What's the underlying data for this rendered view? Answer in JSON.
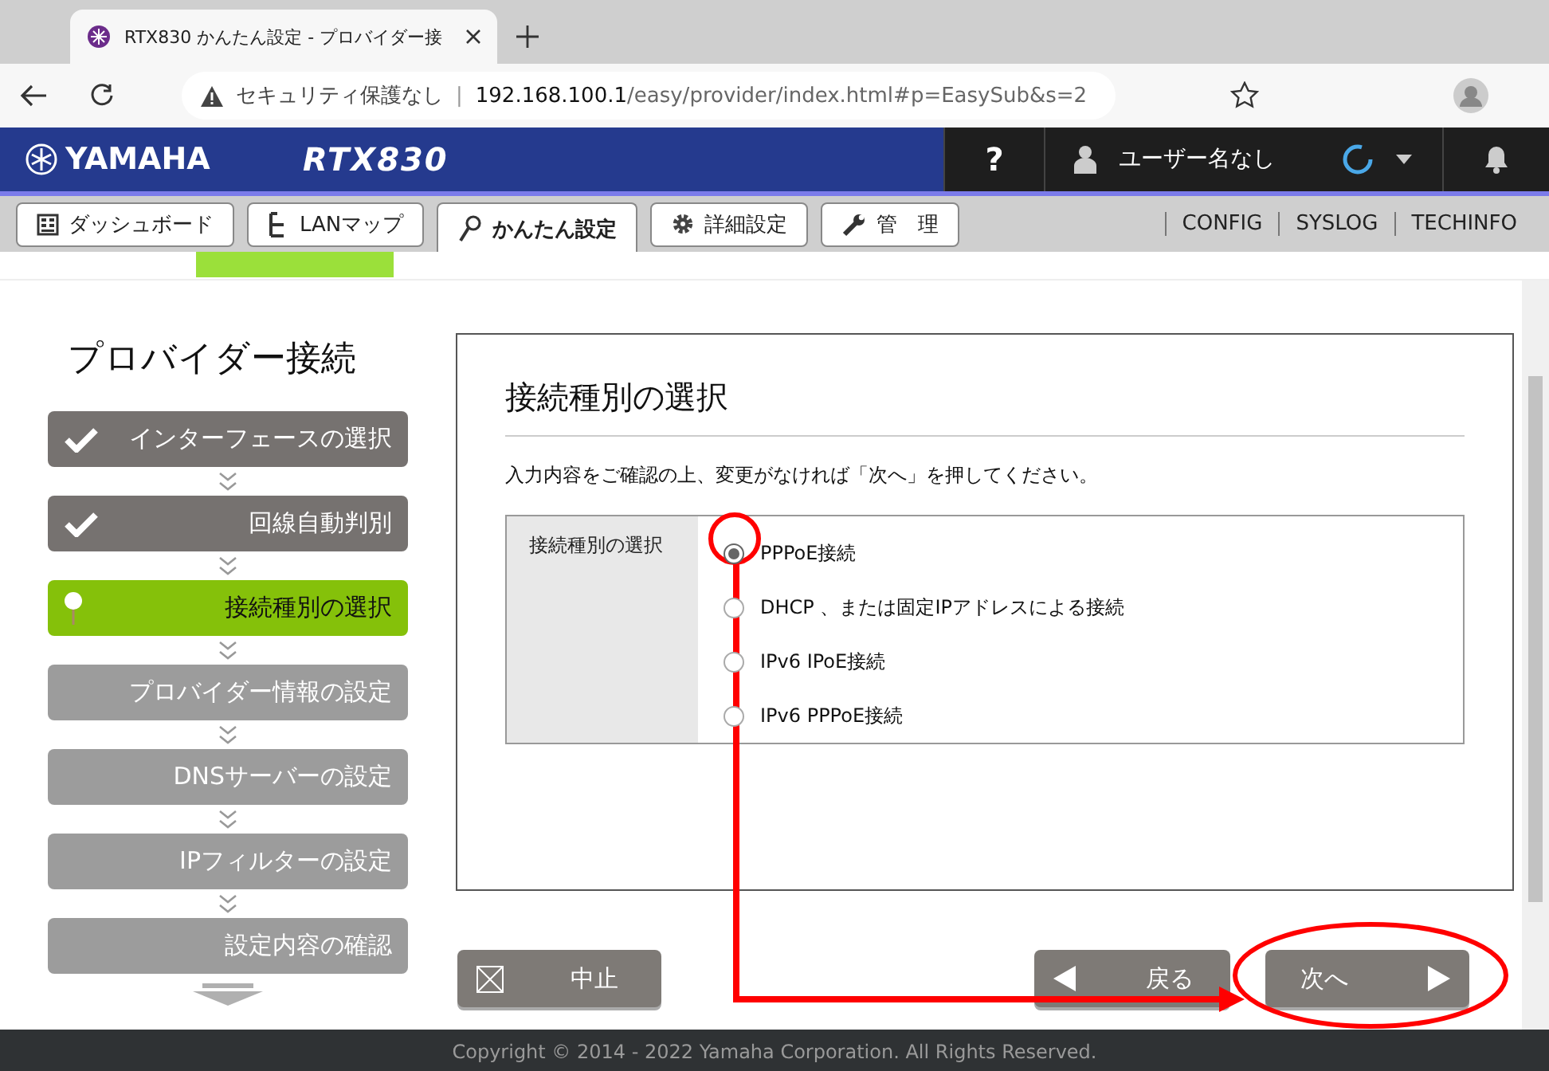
{
  "browser": {
    "tab_title": "RTX830 かんたん設定 - プロバイダー接",
    "address_warning": "セキュリティ保護なし",
    "address_separator": "|",
    "url_host": "192.168.100.1",
    "url_path": "/easy/provider/index.html#p=EasySub&s=2"
  },
  "header": {
    "brand": "YAMAHA",
    "model": "RTX830",
    "help": "?",
    "user": "ユーザー名なし"
  },
  "nav_tabs": [
    {
      "label": "ダッシュボード",
      "selected": false
    },
    {
      "label": "LANマップ",
      "selected": false
    },
    {
      "label": "かんたん設定",
      "selected": true
    },
    {
      "label": "詳細設定",
      "selected": false
    },
    {
      "label": "管　理",
      "selected": false
    }
  ],
  "nav_links": [
    "CONFIG",
    "SYSLOG",
    "TECHINFO"
  ],
  "sidebar": {
    "title": "プロバイダー接続",
    "steps": [
      {
        "label": "インターフェースの選択",
        "kind": "done"
      },
      {
        "label": "回線自動判別",
        "kind": "done"
      },
      {
        "label": "接続種別の選択",
        "kind": "current"
      },
      {
        "label": "プロバイダー情報の設定",
        "kind": "pending"
      },
      {
        "label": "DNSサーバーの設定",
        "kind": "pending"
      },
      {
        "label": "IPフィルターの設定",
        "kind": "pending"
      },
      {
        "label": "設定内容の確認",
        "kind": "pending"
      }
    ]
  },
  "panel": {
    "title": "接続種別の選択",
    "instruction": "入力内容をご確認の上、変更がなければ「次へ」を押してください。",
    "field_label": "接続種別の選択",
    "options": [
      {
        "label": "PPPoE接続",
        "selected": true
      },
      {
        "label": "DHCP 、または固定IPアドレスによる接続",
        "selected": false
      },
      {
        "label": "IPv6 IPoE接続",
        "selected": false
      },
      {
        "label": "IPv6 PPPoE接続",
        "selected": false
      }
    ]
  },
  "buttons": {
    "cancel": "中止",
    "back": "戻る",
    "next": "次へ"
  },
  "footer": "Copyright © 2014 - 2022 Yamaha Corporation. All Rights Reserved."
}
